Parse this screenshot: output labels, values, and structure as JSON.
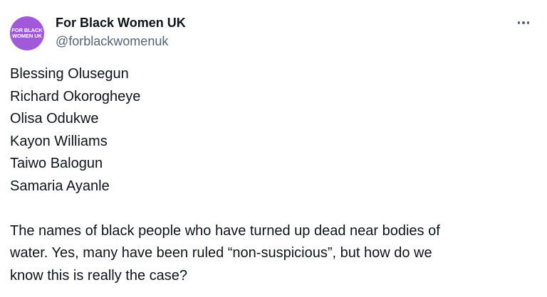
{
  "author": {
    "avatar_text_line1": "FOR BLACK",
    "avatar_text_line2": "WOMEN UK",
    "display_name": "For Black Women UK",
    "handle": "@forblackwomenuk"
  },
  "more_icon": "more-horizontal-icon",
  "tweet": {
    "names": [
      "Blessing Olusegun",
      "Richard Okorogheye",
      "Olisa Odukwe",
      "Kayon Williams",
      "Taiwo Balogun",
      "Samaria Ayanle"
    ],
    "paragraph_line1": "The names of black people who have turned up dead near bodies of",
    "paragraph_line2": "water. Yes, many have been ruled “non-suspicious”, but how do we",
    "paragraph_line3": "know this is really the case?"
  },
  "colors": {
    "avatar_bg": "#a259d9",
    "text_primary": "#0f1419",
    "text_secondary": "#536471"
  }
}
